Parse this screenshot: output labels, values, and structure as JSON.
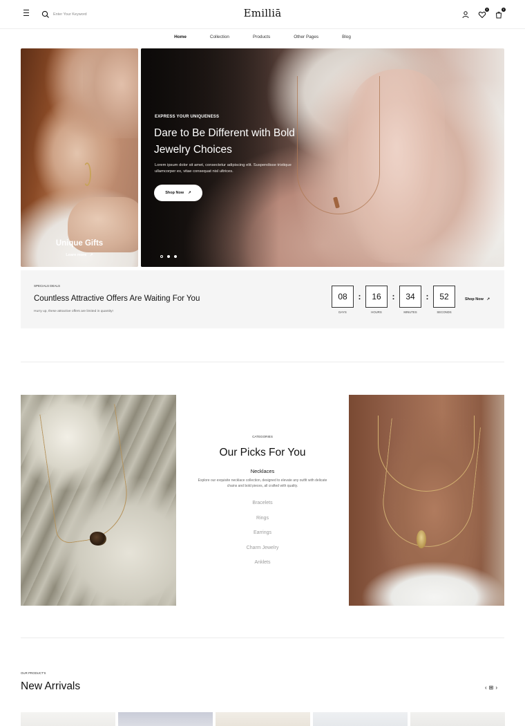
{
  "header": {
    "logo": "Emilliā",
    "search_placeholder": "Enter Your Keyword",
    "wishlist_count": "0",
    "cart_count": "0"
  },
  "nav": {
    "items": [
      {
        "label": "Home",
        "active": true
      },
      {
        "label": "Collection"
      },
      {
        "label": "Products"
      },
      {
        "label": "Other Pages"
      },
      {
        "label": "Blog"
      }
    ]
  },
  "promo": {
    "title": "Unique Gifts",
    "link": "Learn more",
    "link_icon": "↗"
  },
  "hero": {
    "eyebrow": "EXPRESS YOUR UNIQUENESS",
    "title_line1": "Dare to Be Different with Bold",
    "title_line2": "Jewelry Choices",
    "description": "Lorem ipsum dolor sit amet, consectetur adipiscing elit. Suspendisse tristique ullamcorper ex, vitae consequat nisl ultrices.",
    "button": "Shop Now",
    "button_icon": "↗"
  },
  "deals": {
    "label": "SPECIALS DEALS",
    "title": "Countless Attractive Offers Are Waiting For You",
    "subtitle": "Hurry up, these attractive offers are limited in quantity!",
    "timer": {
      "days": "08",
      "hours": "16",
      "minutes": "34",
      "seconds": "52",
      "days_label": "DAYS",
      "hours_label": "HOURS",
      "minutes_label": "MINUTES",
      "seconds_label": "SECONDS",
      "separator": ":"
    },
    "shop_link": "Shop Now",
    "shop_icon": "↗"
  },
  "picks": {
    "label": "CATEGORIES",
    "title": "Our Picks For You",
    "active_category": "Necklaces",
    "description": "Explore our exquisite necklace collection, designed to elevate any outfit with delicate chains and bold pieces, all crafted with quality.",
    "categories": [
      "Bracelets",
      "Rings",
      "Earrings",
      "Charm Jewelry",
      "Anklets"
    ]
  },
  "new_arrivals": {
    "label": "OUR PRODUCT'S",
    "title": "New Arrivals",
    "prev": "‹",
    "grid": "⊞",
    "next": "›"
  },
  "colors": {
    "accent": "#111111",
    "deals_bg": "#f5f5f5",
    "muted_text": "#9a9a9a"
  }
}
